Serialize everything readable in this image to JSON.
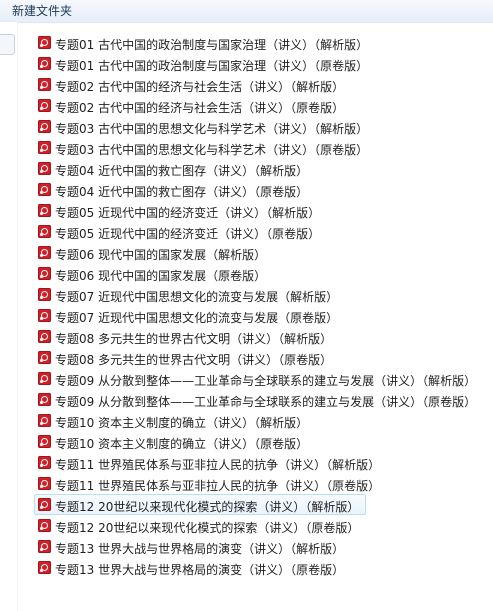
{
  "toolbar": {
    "new_folder_label": "新建文件夹"
  },
  "files": [
    {
      "name": "专题01 古代中国的政治制度与国家治理（讲义）（解析版）",
      "icon": "pdf-icon"
    },
    {
      "name": "专题01 古代中国的政治制度与国家治理（讲义）（原卷版）",
      "icon": "pdf-icon"
    },
    {
      "name": "专题02 古代中国的经济与社会生活（讲义）（解析版）",
      "icon": "pdf-icon"
    },
    {
      "name": "专题02 古代中国的经济与社会生活（讲义）（原卷版）",
      "icon": "pdf-icon"
    },
    {
      "name": "专题03 古代中国的思想文化与科学艺术（讲义）（解析版）",
      "icon": "pdf-icon"
    },
    {
      "name": "专题03 古代中国的思想文化与科学艺术（讲义）（原卷版）",
      "icon": "pdf-icon"
    },
    {
      "name": "专题04 近代中国的救亡图存（讲义）（解析版）",
      "icon": "pdf-icon"
    },
    {
      "name": "专题04 近代中国的救亡图存（讲义）（原卷版）",
      "icon": "pdf-icon"
    },
    {
      "name": "专题05 近现代中国的经济变迁（讲义）（解析版）",
      "icon": "pdf-icon"
    },
    {
      "name": "专题05 近现代中国的经济变迁（讲义）（原卷版）",
      "icon": "pdf-icon"
    },
    {
      "name": "专题06 现代中国的国家发展（解析版）",
      "icon": "pdf-icon"
    },
    {
      "name": "专题06 现代中国的国家发展（原卷版）",
      "icon": "pdf-icon"
    },
    {
      "name": "专题07 近现代中国思想文化的流变与发展（解析版）",
      "icon": "pdf-icon"
    },
    {
      "name": "专题07 近现代中国思想文化的流变与发展（原卷版）",
      "icon": "pdf-icon"
    },
    {
      "name": "专题08 多元共生的世界古代文明（讲义）（解析版）",
      "icon": "pdf-icon"
    },
    {
      "name": "专题08 多元共生的世界古代文明（讲义）（原卷版）",
      "icon": "pdf-icon"
    },
    {
      "name": "专题09 从分散到整体——工业革命与全球联系的建立与发展（讲义）（解析版）",
      "icon": "pdf-icon"
    },
    {
      "name": "专题09 从分散到整体——工业革命与全球联系的建立与发展（讲义）（原卷版）",
      "icon": "pdf-icon"
    },
    {
      "name": "专题10 资本主义制度的确立（讲义）（解析版）",
      "icon": "pdf-icon"
    },
    {
      "name": "专题10 资本主义制度的确立（讲义）（原卷版）",
      "icon": "pdf-icon"
    },
    {
      "name": "专题11 世界殖民体系与亚非拉人民的抗争（讲义）（解析版）",
      "icon": "pdf-icon"
    },
    {
      "name": "专题11 世界殖民体系与亚非拉人民的抗争（讲义）（原卷版）",
      "icon": "pdf-icon"
    },
    {
      "name": "专题12 20世纪以来现代化模式的探索（讲义）（解析版）",
      "icon": "pdf-icon",
      "hovered": true
    },
    {
      "name": "专题12 20世纪以来现代化模式的探索（讲义）（原卷版）",
      "icon": "pdf-icon"
    },
    {
      "name": "专题13 世界大战与世界格局的演变（讲义）（解析版）",
      "icon": "pdf-icon"
    },
    {
      "name": "专题13 世界大战与世界格局的演变（讲义）（原卷版）",
      "icon": "pdf-icon"
    }
  ]
}
